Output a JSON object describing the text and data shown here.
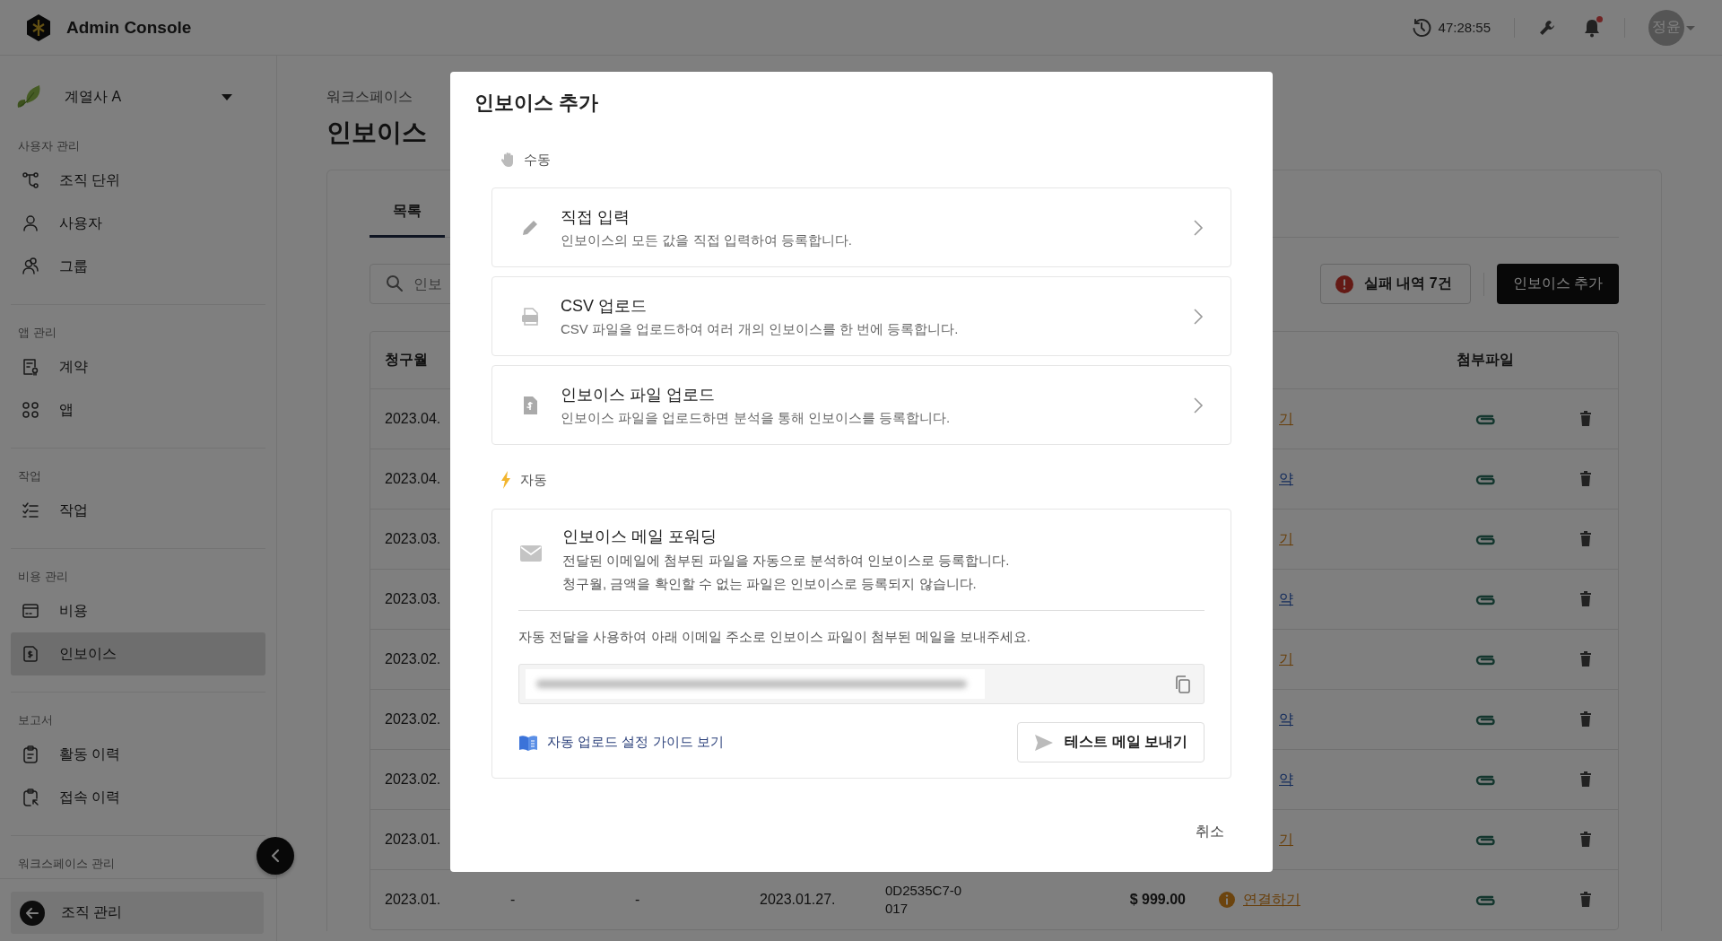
{
  "topbar": {
    "title": "Admin Console",
    "clock": "47:28:55",
    "avatar": "정윤",
    "notification": true
  },
  "sidebar": {
    "organization": "계열사 A",
    "sections": [
      {
        "label": "사용자 관리",
        "items": [
          {
            "label": "조직 단위",
            "selected": false
          },
          {
            "label": "사용자",
            "selected": false
          },
          {
            "label": "그룹",
            "selected": false
          }
        ]
      },
      {
        "label": "앱 관리",
        "items": [
          {
            "label": "계약",
            "selected": false
          },
          {
            "label": "앱",
            "selected": false
          }
        ]
      },
      {
        "label": "작업",
        "items": [
          {
            "label": "작업",
            "selected": false
          }
        ]
      },
      {
        "label": "비용 관리",
        "items": [
          {
            "label": "비용",
            "selected": false
          },
          {
            "label": "인보이스",
            "selected": true
          }
        ]
      },
      {
        "label": "보고서",
        "items": [
          {
            "label": "활동 이력",
            "selected": false
          },
          {
            "label": "접속 이력",
            "selected": false
          }
        ]
      },
      {
        "label": "워크스페이스 관리"
      }
    ],
    "footer": "조직 관리"
  },
  "page": {
    "breadcrumb": "워크스페이스",
    "title": "인보이스",
    "tabs": [
      {
        "label": "목록",
        "selected": true
      }
    ],
    "search": {
      "placeholder": "인보"
    },
    "failed_button": "실패 내역 7건",
    "add_button": "인보이스 추가",
    "columns": [
      {
        "label": "청구월"
      },
      {
        "label": "첨부파일"
      }
    ],
    "rows": [
      {
        "month": "2023.04.",
        "link": {
          "text": "기",
          "kind": "connect"
        }
      },
      {
        "month": "2023.04.",
        "link": {
          "text": "약",
          "kind": "contract"
        }
      },
      {
        "month": "2023.03.",
        "link": {
          "text": "기",
          "kind": "connect"
        }
      },
      {
        "month": "2023.03.",
        "link": {
          "text": "약",
          "kind": "contract"
        }
      },
      {
        "month": "2023.02.",
        "link": {
          "text": "기",
          "kind": "connect"
        }
      },
      {
        "month": "2023.02.",
        "link": {
          "text": "약",
          "kind": "contract"
        }
      },
      {
        "month": "2023.02.",
        "link": {
          "text": "약",
          "kind": "contract"
        }
      },
      {
        "month": "2023.01.",
        "link": {
          "text": "기",
          "kind": "connect"
        }
      },
      {
        "month": "2023.01.",
        "column_2": "-",
        "column_3": "-",
        "column_4": "2023.01.27.",
        "column_5": "0D2535C7-0017",
        "column_6": "$ 999.00",
        "link": {
          "text": "연결하기",
          "kind": "connect",
          "alert": true
        }
      }
    ]
  },
  "dialog": {
    "title": "인보이스 추가",
    "manual": {
      "label": "수동",
      "options": [
        {
          "title": "직접 입력",
          "description": "인보이스의 모든 값을 직접 입력하여 등록합니다."
        },
        {
          "title": "CSV 업로드",
          "description": "CSV 파일을 업로드하여 여러 개의 인보이스를 한 번에 등록합니다."
        },
        {
          "title": "인보이스 파일 업로드",
          "description": "인보이스 파일을 업로드하면 분석을 통해 인보이스를 등록합니다."
        }
      ]
    },
    "auto": {
      "label": "자동",
      "title": "인보이스 메일 포워딩",
      "description": [
        "전달된 이메일에 첨부된 파일을 자동으로 분석하여 인보이스로 등록합니다.",
        "청구월, 금액을 확인할 수 없는 파일은 인보이스로 등록되지 않습니다."
      ],
      "instruction": "자동 전달을 사용하여 아래 이메일 주소로 인보이스 파일이 첨부된 메일을 보내주세요.",
      "guide_link": "자동 업로드 설정 가이드 보기",
      "test_button": "테스트 메일 보내기"
    },
    "cancel": "취소"
  }
}
